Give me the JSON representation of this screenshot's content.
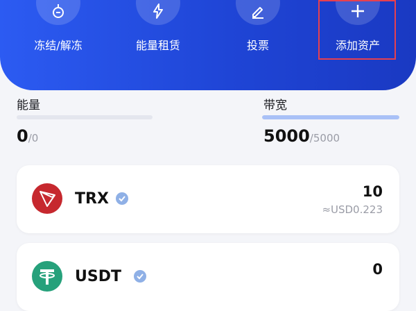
{
  "actions": [
    {
      "label": "冻结/解冻",
      "icon": "freeze-icon"
    },
    {
      "label": "能量租赁",
      "icon": "lightning-icon"
    },
    {
      "label": "投票",
      "icon": "vote-pen-icon"
    },
    {
      "label": "添加资产",
      "icon": "plus-icon"
    }
  ],
  "resources": {
    "energy": {
      "title": "能量",
      "value": "0",
      "max": "/0",
      "fill": 0
    },
    "bandwidth": {
      "title": "带宽",
      "value": "5000",
      "max": "/5000",
      "fill": 1
    }
  },
  "tokens": [
    {
      "name": "TRX",
      "amount": "10",
      "fiat": "≈USD0.223",
      "icon": "tron-logo-icon",
      "icon_color": "#c6282e"
    },
    {
      "name": "USDT",
      "amount": "0",
      "fiat": "",
      "icon": "tether-logo-icon",
      "icon_color": "#26a17b"
    }
  ],
  "colors": {
    "brand": "#1f45d6",
    "highlight": "#e6404f",
    "verified": "#8fb0e6"
  }
}
